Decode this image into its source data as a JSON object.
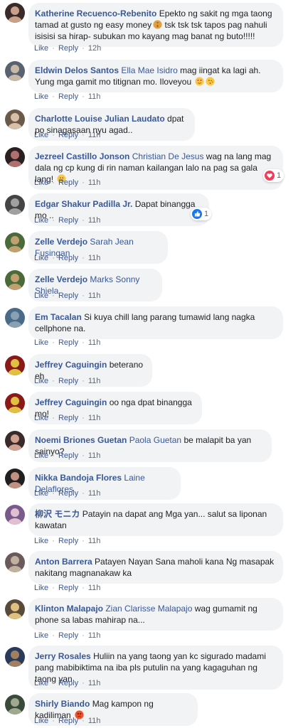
{
  "labels": {
    "like": "Like",
    "reply": "Reply"
  },
  "comments": [
    {
      "author": "Katherine Recuenco-Rebenito",
      "mention": "",
      "text": "Epekto ng sakit ng mga taong tamad at gusto ng easy money",
      "text2": "tsk tsk tsk tapos pag nahuli isisisi sa hirap- subukan mo kayang mag banat ng buto!!!!!",
      "time": "12h"
    },
    {
      "author": "Eldwin Delos Santos",
      "mention": "Ella Mae Isidro",
      "text": "mag iingat ka lagi ah. Yung mga gamit mo titignan mo. Iloveyou",
      "time": "11h"
    },
    {
      "author": "Charlotte Louise Julian Laudato",
      "mention": "",
      "text": "dpat po sinagasaan nyu agad..",
      "time": "11h"
    },
    {
      "author": "Jezreel Castillo Jonson",
      "mention": "Christian De Jesus",
      "text": "wag na lang mag dala ng cp kung di rin naman kailangan lalo na pag sa gala lang!",
      "time": "11h",
      "reaction": "1"
    },
    {
      "author": "Edgar Shakur Padilla Jr.",
      "mention": "",
      "text": "Dapat binangga mo ..",
      "time": "11h",
      "reaction": "1"
    },
    {
      "author": "Zelle Verdejo",
      "mention": "Sarah Jean Fusingan",
      "text": "",
      "time": "11h"
    },
    {
      "author": "Zelle Verdejo",
      "mention": "Marks Sonny Shiela",
      "text": "",
      "time": "11h"
    },
    {
      "author": "Em Tacalan",
      "mention": "",
      "text": "Si kuya chill lang parang tumawid lang nagka cellphone na.",
      "time": "11h"
    },
    {
      "author": "Jeffrey Caguingin",
      "mention": "",
      "text": "beterano eh",
      "time": "11h"
    },
    {
      "author": "Jeffrey Caguingin",
      "mention": "",
      "text": "oo nga dpat binangga mo!",
      "time": "11h"
    },
    {
      "author": "Noemi Briones Guetan",
      "mention": "Paola Guetan",
      "text": "be malapit ba yan sainyo?",
      "time": "11h"
    },
    {
      "author": "Nikka Bandoja Flores",
      "mention": "Laine Delaflores",
      "text": "",
      "time": "11h"
    },
    {
      "author": "柳沢 モニカ",
      "mention": "",
      "text": "Patayin na dapat ang Mga yan... salut sa liponan kawatan",
      "time": "11h"
    },
    {
      "author": "Anton Barrera",
      "mention": "",
      "text": "Patayen Nayan Sana maholi kana Ng masapak nakitang magnanakaw ka",
      "time": "11h"
    },
    {
      "author": "Klinton Malapajo",
      "mention": "Zian Clarisse Malapajo",
      "text": "wag gumamit ng phone sa labas mahirap na...",
      "time": "11h"
    },
    {
      "author": "Jerry Rosales",
      "mention": "",
      "text": "Huliin na yang taong yan kc sigurado madami pang mabibiktima na iba pls putulin na yang kagaguhan ng taong yan",
      "time": "11h"
    },
    {
      "author": "Shirly Biando",
      "mention": "",
      "text": "Mag kampon ng kadiliman",
      "time": "11h"
    }
  ],
  "colors": {
    "link": "#385898",
    "bubble": "#f2f3f5",
    "meta": "#616770",
    "like": "#1877f2",
    "love": "#f33e58"
  }
}
